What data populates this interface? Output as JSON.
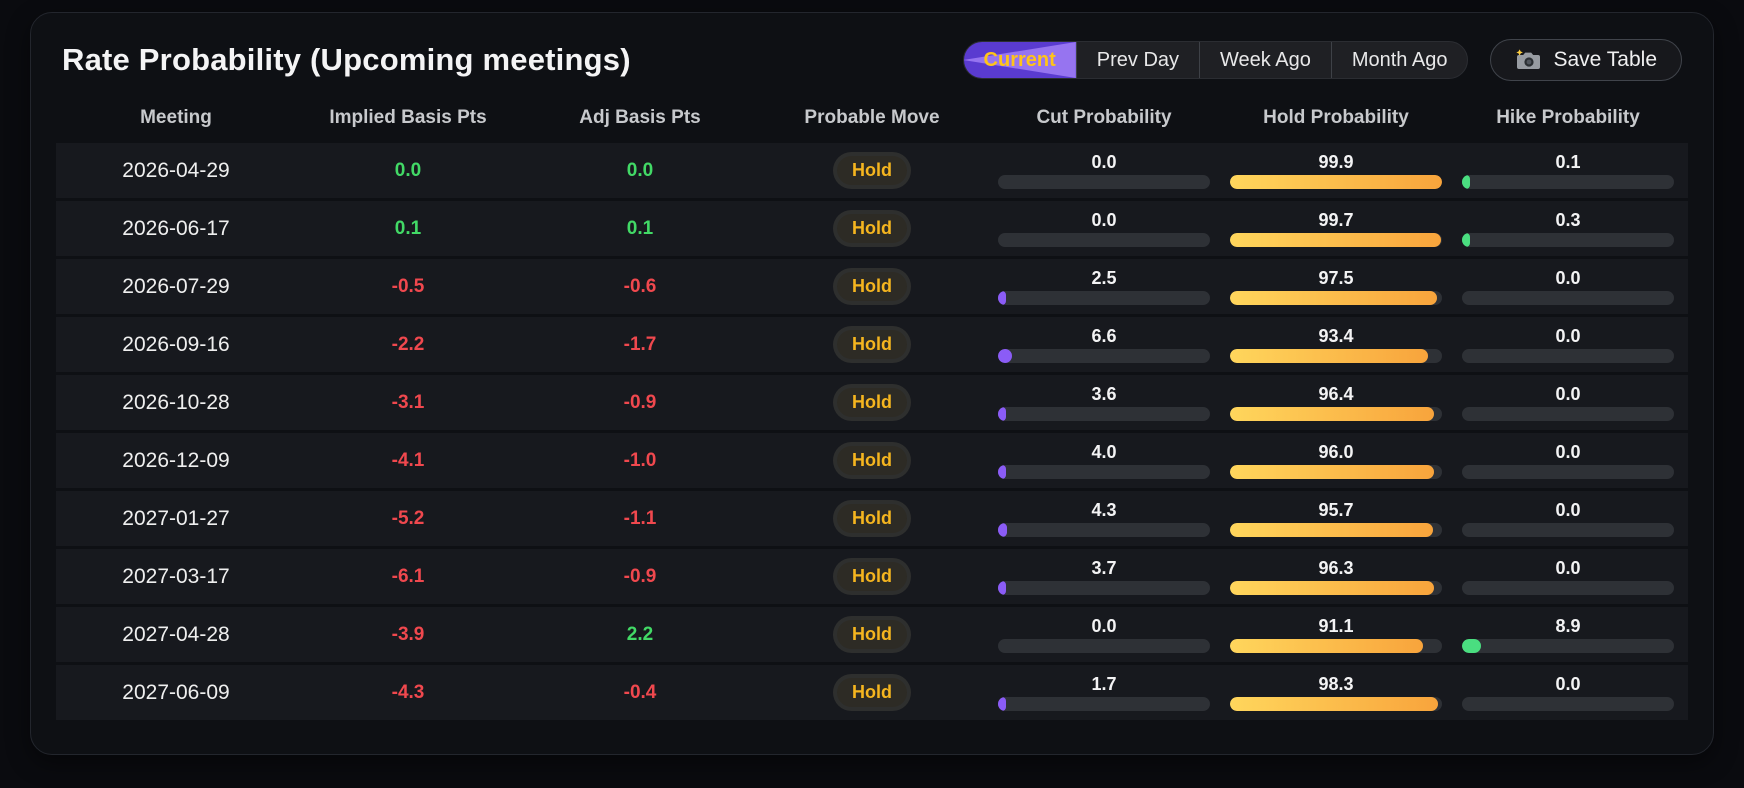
{
  "title": "Rate Probability (Upcoming meetings)",
  "tabs": [
    {
      "label": "Current",
      "active": true
    },
    {
      "label": "Prev Day",
      "active": false
    },
    {
      "label": "Week Ago",
      "active": false
    },
    {
      "label": "Month Ago",
      "active": false
    }
  ],
  "save_button": {
    "label": "Save Table",
    "icon": "camera-icon"
  },
  "table": {
    "columns": [
      "Meeting",
      "Implied Basis Pts",
      "Adj Basis Pts",
      "Probable Move",
      "Cut Probability",
      "Hold Probability",
      "Hike Probability"
    ],
    "rows": [
      {
        "meeting": "2026-04-29",
        "implied": "0.0",
        "adj": "0.0",
        "move": "Hold",
        "cut": "0.0",
        "hold": "99.9",
        "hike": "0.1"
      },
      {
        "meeting": "2026-06-17",
        "implied": "0.1",
        "adj": "0.1",
        "move": "Hold",
        "cut": "0.0",
        "hold": "99.7",
        "hike": "0.3"
      },
      {
        "meeting": "2026-07-29",
        "implied": "-0.5",
        "adj": "-0.6",
        "move": "Hold",
        "cut": "2.5",
        "hold": "97.5",
        "hike": "0.0"
      },
      {
        "meeting": "2026-09-16",
        "implied": "-2.2",
        "adj": "-1.7",
        "move": "Hold",
        "cut": "6.6",
        "hold": "93.4",
        "hike": "0.0"
      },
      {
        "meeting": "2026-10-28",
        "implied": "-3.1",
        "adj": "-0.9",
        "move": "Hold",
        "cut": "3.6",
        "hold": "96.4",
        "hike": "0.0"
      },
      {
        "meeting": "2026-12-09",
        "implied": "-4.1",
        "adj": "-1.0",
        "move": "Hold",
        "cut": "4.0",
        "hold": "96.0",
        "hike": "0.0"
      },
      {
        "meeting": "2027-01-27",
        "implied": "-5.2",
        "adj": "-1.1",
        "move": "Hold",
        "cut": "4.3",
        "hold": "95.7",
        "hike": "0.0"
      },
      {
        "meeting": "2027-03-17",
        "implied": "-6.1",
        "adj": "-0.9",
        "move": "Hold",
        "cut": "3.7",
        "hold": "96.3",
        "hike": "0.0"
      },
      {
        "meeting": "2027-04-28",
        "implied": "-3.9",
        "adj": "2.2",
        "move": "Hold",
        "cut": "0.0",
        "hold": "91.1",
        "hike": "8.9"
      },
      {
        "meeting": "2027-06-09",
        "implied": "-4.3",
        "adj": "-0.4",
        "move": "Hold",
        "cut": "1.7",
        "hold": "98.3",
        "hike": "0.0"
      }
    ]
  },
  "colors": {
    "positive": "#42d966",
    "negative": "#f0484e",
    "cut_bar": "#8b5cf6",
    "hike_bar": "#4ade80",
    "hold_bar_start": "#ffd65c",
    "hold_bar_end": "#f8a43c",
    "tab_active_base": "#5a3bd0",
    "tab_active_wedge": "#9674f0",
    "tab_active_label": "#ffc419",
    "badge_text": "#f5b51f"
  }
}
